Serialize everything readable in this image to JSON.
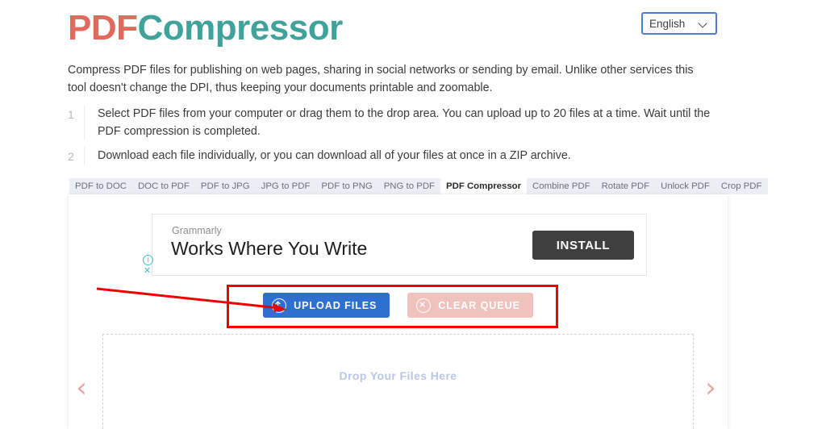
{
  "header": {
    "logo_primary": "PDF",
    "logo_secondary": "Compressor",
    "language": {
      "selected": "English",
      "chevron_icon": "chevron-down-icon"
    }
  },
  "intro": {
    "text": "Compress PDF files for publishing on web pages, sharing in social networks or sending by email. Unlike other services this tool doesn't change the DPI, thus keeping your documents printable and zoomable."
  },
  "steps": [
    {
      "number": "1",
      "text": "Select PDF files from your computer or drag them to the drop area. You can upload up to 20 files at a time. Wait until the PDF compression is completed."
    },
    {
      "number": "2",
      "text": "Download each file individually, or you can download all of your files at once in a ZIP archive."
    }
  ],
  "tabs": [
    {
      "label": "PDF to DOC",
      "active": false
    },
    {
      "label": "DOC to PDF",
      "active": false
    },
    {
      "label": "PDF to JPG",
      "active": false
    },
    {
      "label": "JPG to PDF",
      "active": false
    },
    {
      "label": "PDF to PNG",
      "active": false
    },
    {
      "label": "PNG to PDF",
      "active": false
    },
    {
      "label": "PDF Compressor",
      "active": true
    },
    {
      "label": "Combine PDF",
      "active": false
    },
    {
      "label": "Rotate PDF",
      "active": false
    },
    {
      "label": "Unlock PDF",
      "active": false
    },
    {
      "label": "Crop PDF",
      "active": false
    }
  ],
  "ad": {
    "brand": "Grammarly",
    "headline": "Works Where You Write",
    "install_label": "INSTALL",
    "info_icon": "info-icon",
    "info_glyph": "i",
    "close_icon": "close-icon",
    "close_glyph": "✕"
  },
  "actions": {
    "upload": {
      "label": "UPLOAD FILES",
      "icon": "upload-arrow-icon",
      "color": "#2f6fd0"
    },
    "clear": {
      "label": "CLEAR QUEUE",
      "icon": "cancel-circle-icon",
      "color": "#f0c2bd",
      "disabled": true
    }
  },
  "dropzone": {
    "text": "Drop Your Files Here",
    "prev_icon": "chevron-left-icon",
    "prev_glyph": "‹",
    "next_icon": "chevron-right-icon",
    "next_glyph": "›"
  },
  "annotation": {
    "highlight_color": "#ef0000",
    "target": "UPLOAD FILES"
  }
}
